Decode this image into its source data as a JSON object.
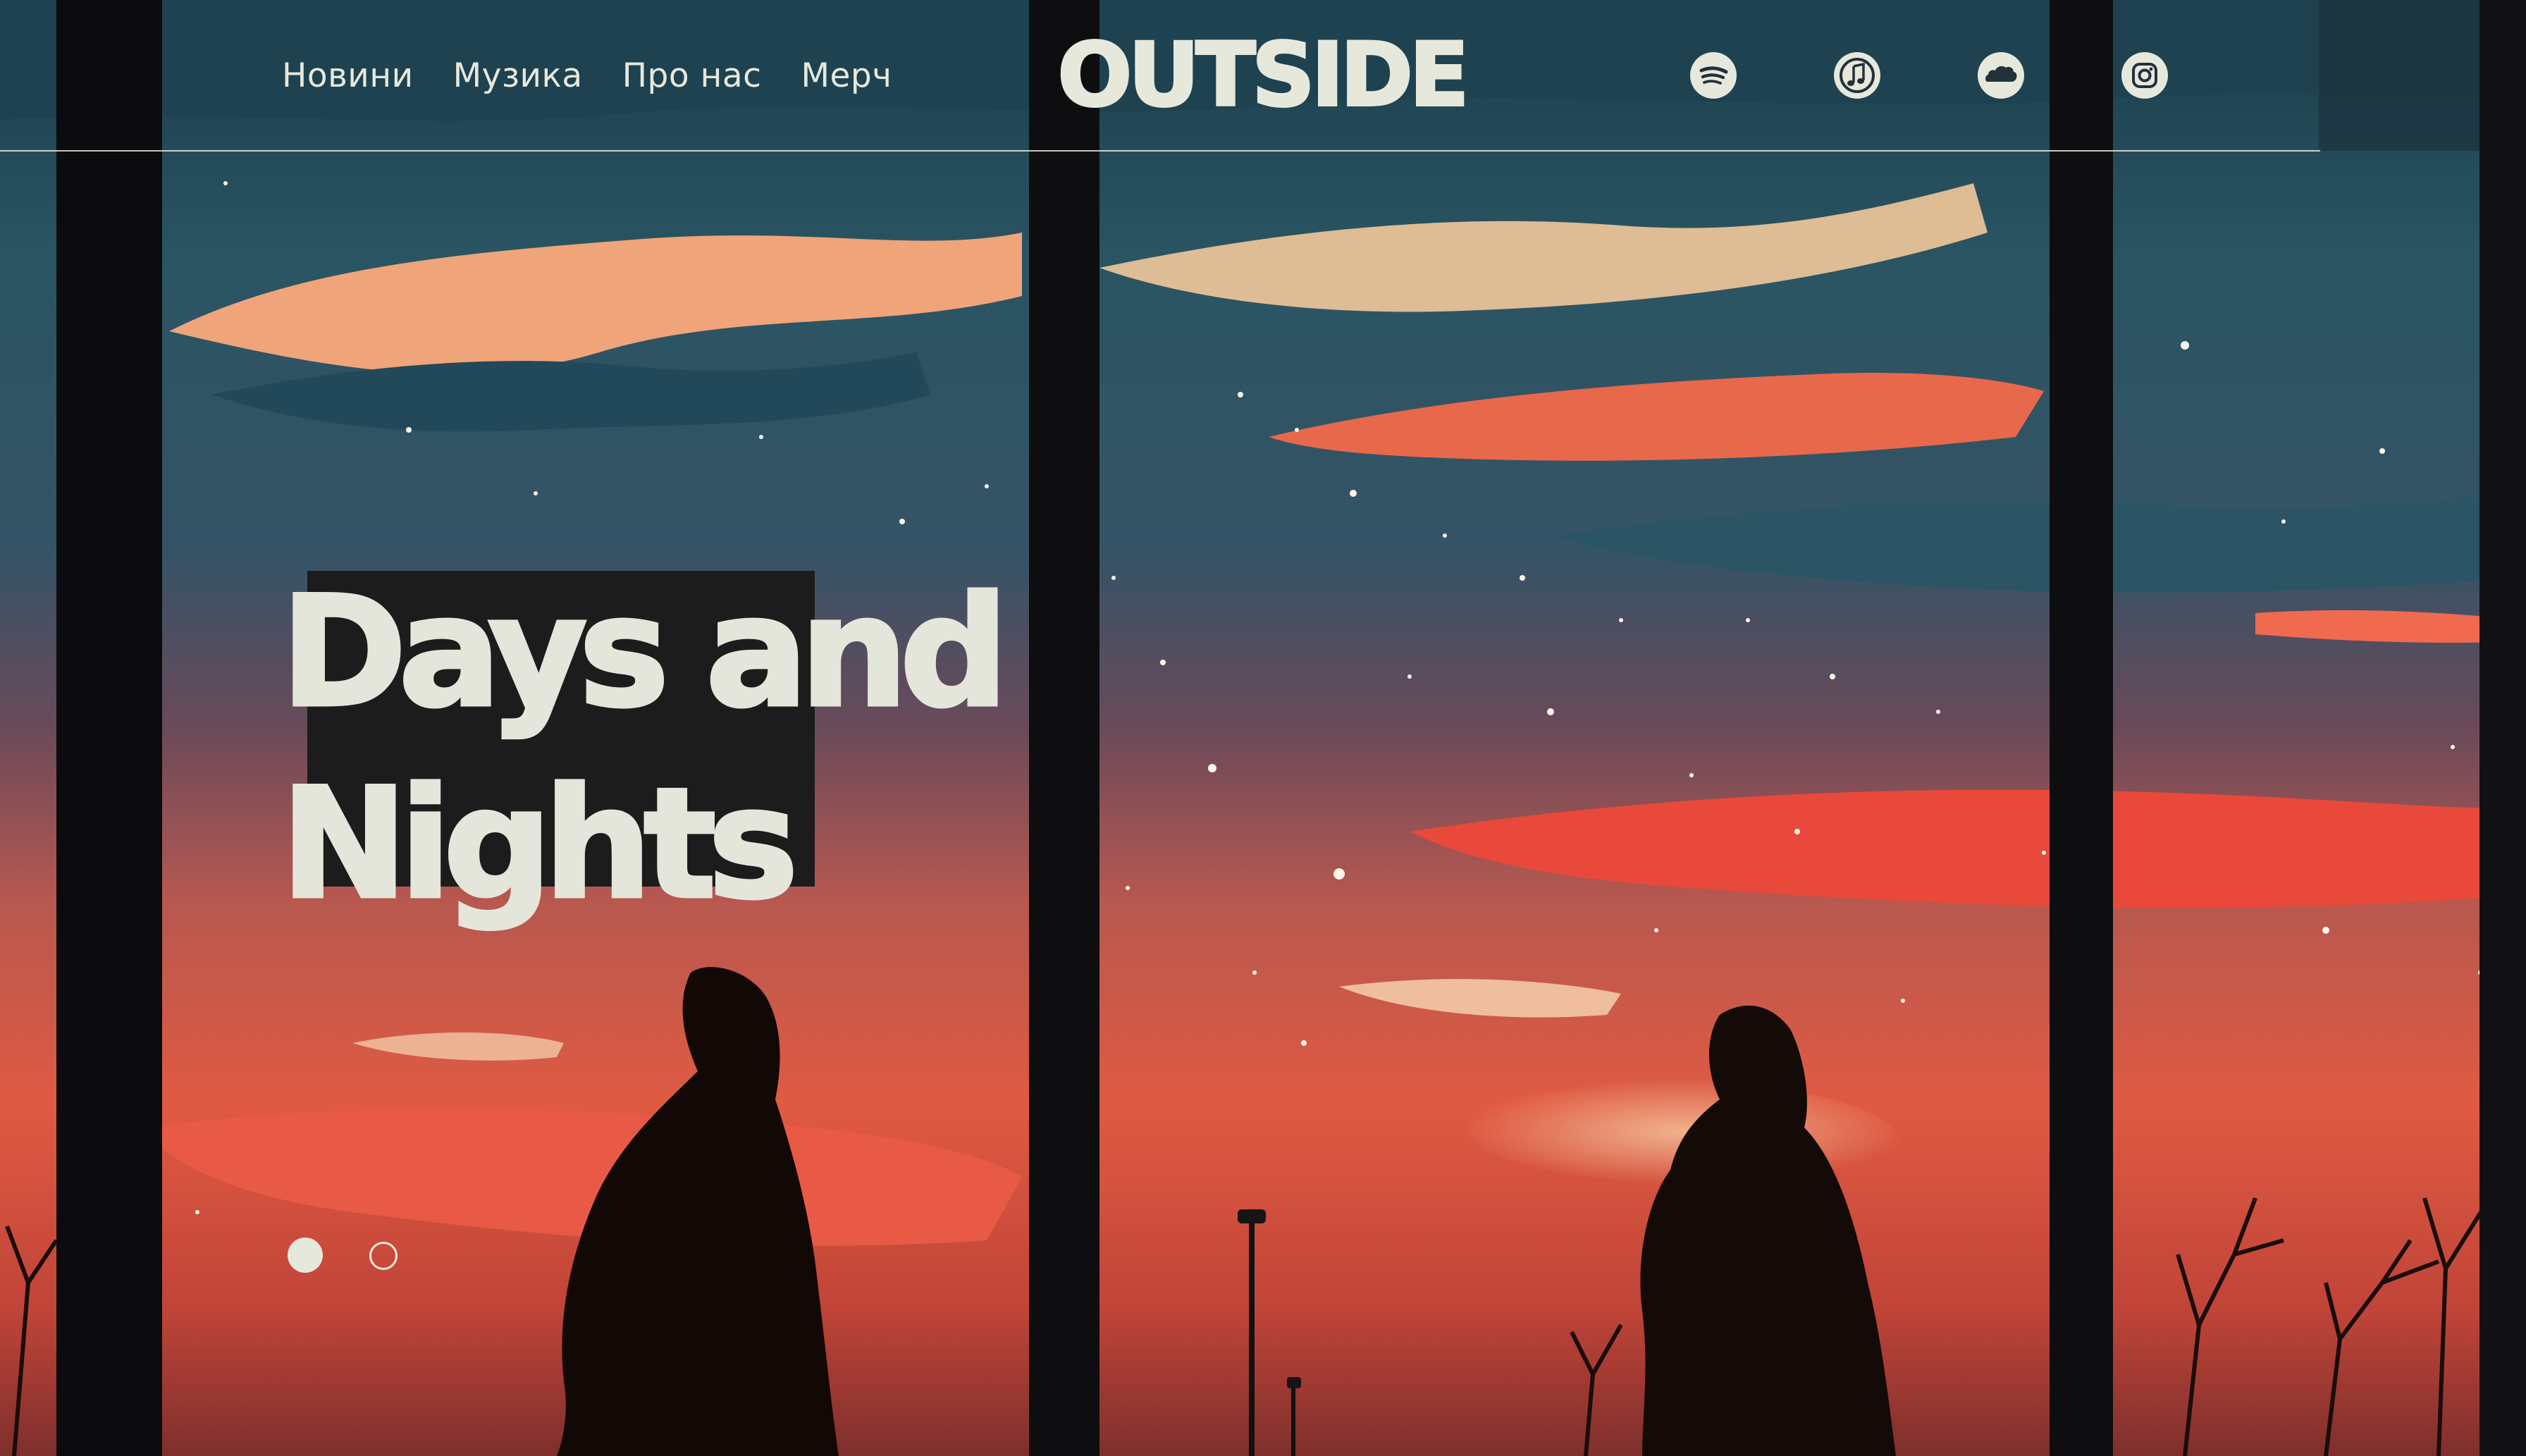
{
  "nav": {
    "items": [
      {
        "label": "Новини"
      },
      {
        "label": "Музика"
      },
      {
        "label": "Про нас"
      },
      {
        "label": "Мерч"
      }
    ]
  },
  "brand": {
    "logo_text": "OUTSIDE"
  },
  "social": [
    {
      "icon": "spotify-icon"
    },
    {
      "icon": "apple-music-icon"
    },
    {
      "icon": "soundcloud-icon"
    },
    {
      "icon": "instagram-icon"
    }
  ],
  "hero": {
    "title_line1": "Days and",
    "title_line2": "Nights"
  },
  "slider": {
    "slide_count": 2,
    "active_index": 0
  },
  "colors": {
    "text_cream": "#e7e8dc",
    "title_backdrop": "#1c1c1c",
    "sky_teal": "#2c5866",
    "sunset_red": "#e4543f",
    "sunset_peach": "#f1a178"
  }
}
